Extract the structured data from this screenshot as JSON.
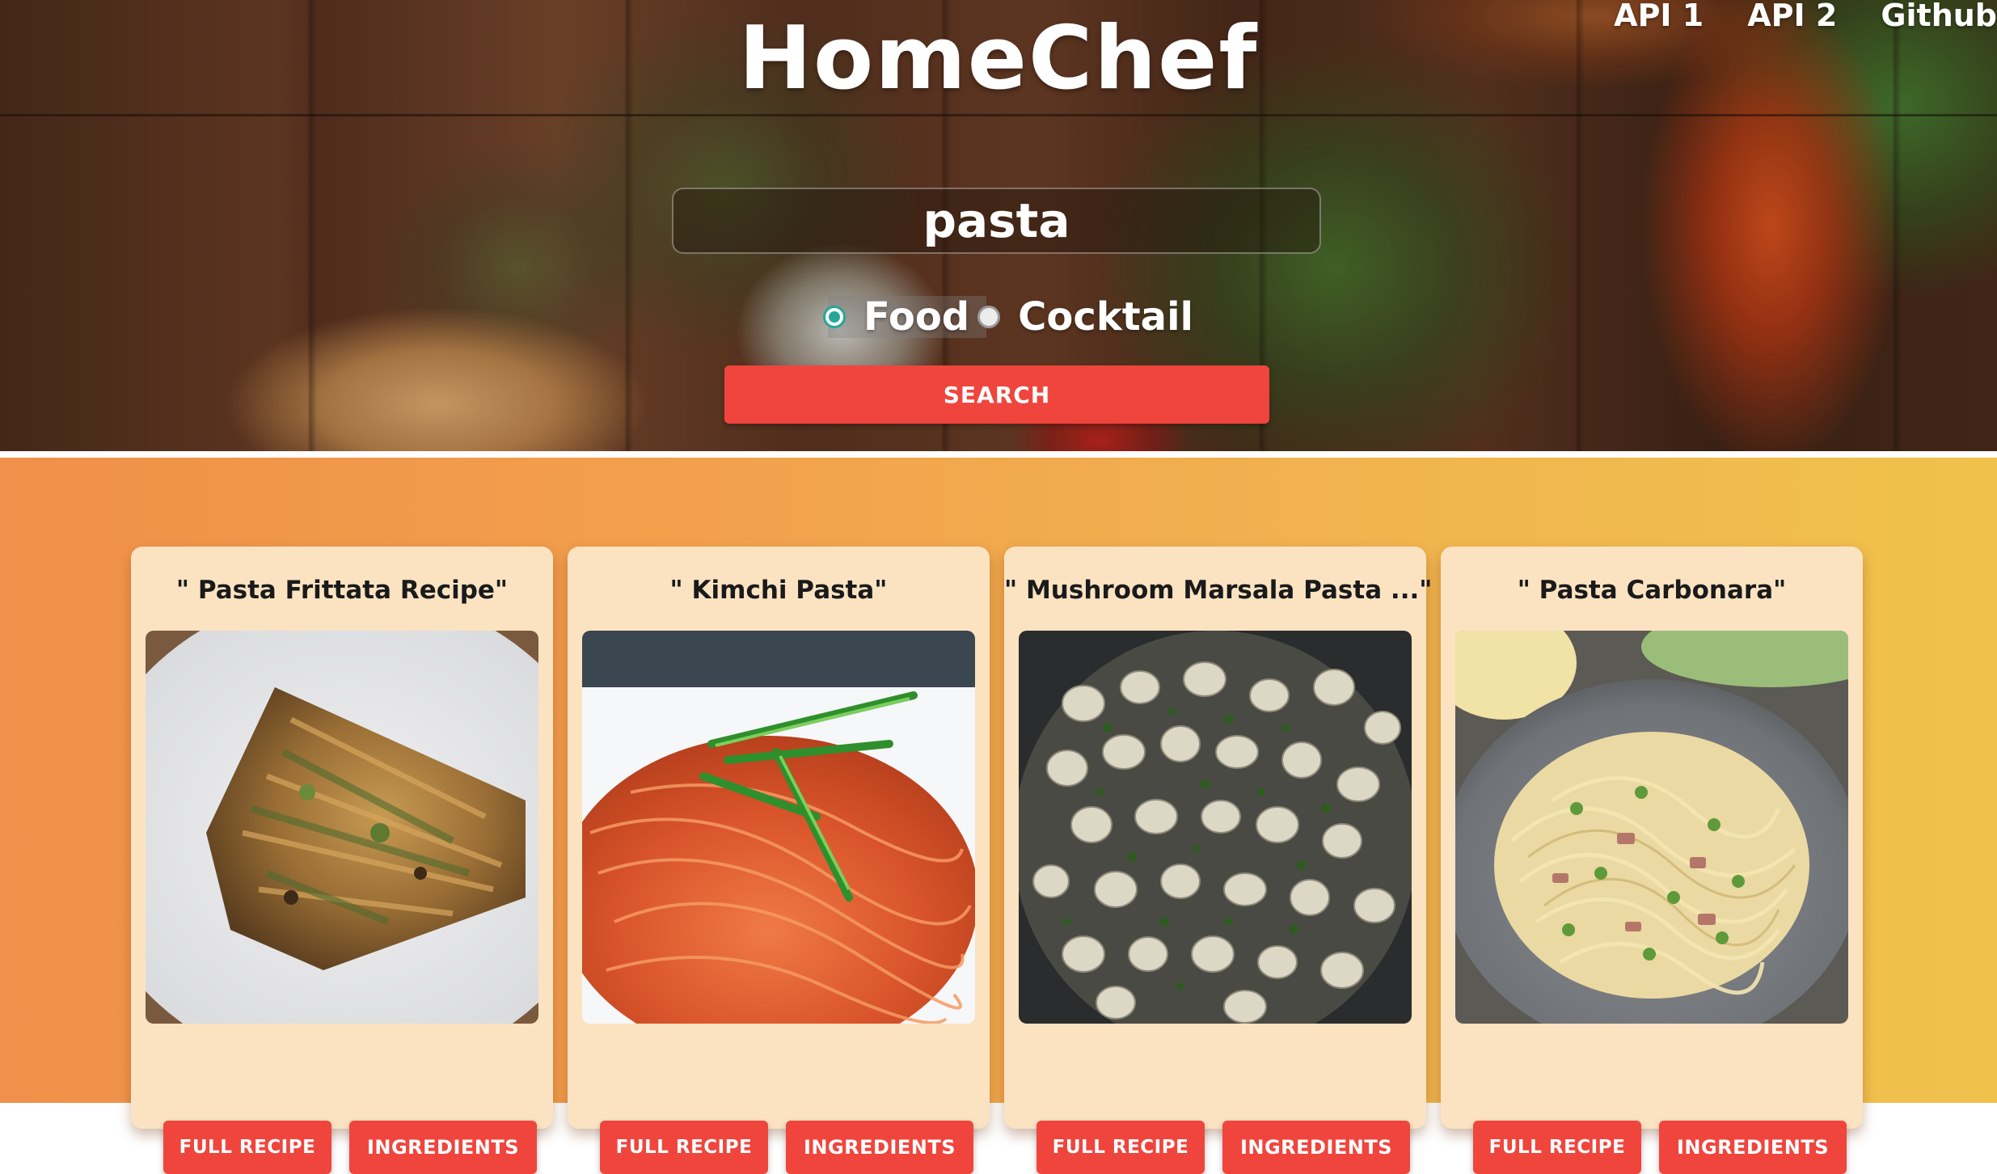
{
  "header": {
    "brand": "HomeChef",
    "nav": [
      "API 1",
      "API 2",
      "Github"
    ]
  },
  "search": {
    "value": "pasta",
    "options": [
      {
        "label": "Food",
        "checked": true
      },
      {
        "label": "Cocktail",
        "checked": false
      }
    ],
    "button_label": "SEARCH"
  },
  "results": [
    {
      "title": "\" Pasta Frittata Recipe\"",
      "image": "pasta-frittata-photo",
      "recipe_label": "FULL RECIPE",
      "ingredients_label": "INGREDIENTS"
    },
    {
      "title": "\" Kimchi Pasta\"",
      "image": "kimchi-pasta-photo",
      "recipe_label": "FULL RECIPE",
      "ingredients_label": "INGREDIENTS"
    },
    {
      "title": "\" Mushroom Marsala Pasta ...\"",
      "image": "mushroom-marsala-pasta-photo",
      "recipe_label": "FULL RECIPE",
      "ingredients_label": "INGREDIENTS"
    },
    {
      "title": "\" Pasta Carbonara\"",
      "image": "pasta-carbonara-photo",
      "recipe_label": "FULL RECIPE",
      "ingredients_label": "INGREDIENTS"
    }
  ],
  "colors": {
    "accent_button": "#f0453d",
    "card_bg": "#fbe3c2",
    "radio_checked": "#26a69a",
    "results_gradient_start": "#f0904a",
    "results_gradient_end": "#f0c24c"
  }
}
